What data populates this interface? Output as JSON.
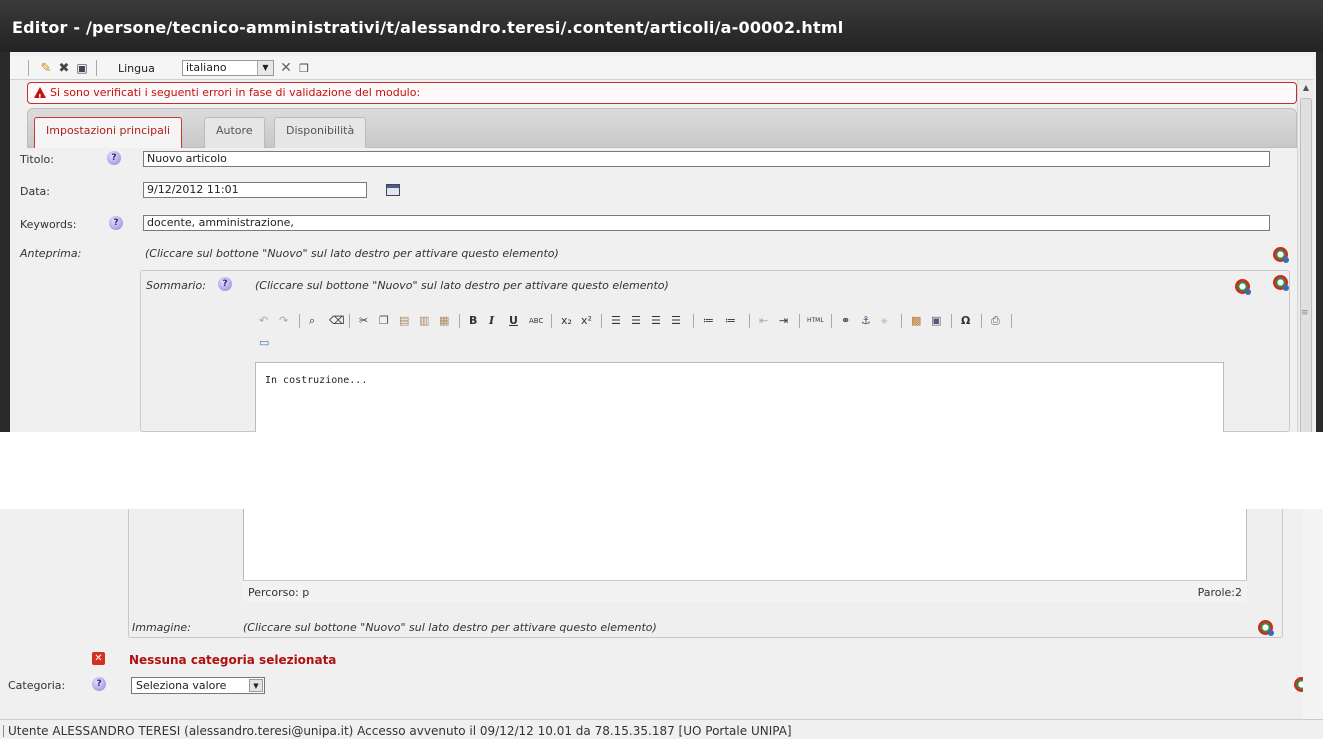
{
  "window": {
    "title": "Editor - /persone/tecnico-amministrativi/t/alessandro.teresi/.content/articoli/a-00002.html"
  },
  "toolbar": {
    "icons": [
      "publish-icon",
      "delete-icon",
      "save-icon"
    ],
    "lingua_label": "Lingua",
    "lingua_value": "italiano",
    "copy_icon": "copy-locale-icon",
    "delete_locale_icon": "delete-locale-icon"
  },
  "error_banner": {
    "text": "Si sono verificati i seguenti errori in fase di validazione del modulo:"
  },
  "tabs": [
    {
      "label": "Impostazioni principali",
      "active": true
    },
    {
      "label": "Autore",
      "active": false
    },
    {
      "label": "Disponibilità",
      "active": false
    }
  ],
  "form": {
    "titolo_label": "Titolo:",
    "titolo_value": "Nuovo articolo",
    "data_label": "Data:",
    "data_value": "9/12/2012 11:01",
    "keywords_label": "Keywords:",
    "keywords_value": "docente, amministrazione,",
    "anteprima_label": "Anteprima:",
    "anteprima_hint": "(Cliccare sul bottone \"Nuovo\" sul lato destro per attivare questo elemento)",
    "sommario_label": "Sommario:",
    "sommario_hint": "(Cliccare sul bottone \"Nuovo\" sul lato destro per attivare questo elemento)",
    "help_symbol": "?"
  },
  "editor": {
    "content": "In costruzione...",
    "path_label": "Percorso: p",
    "word_count_label": "Parole:2",
    "buttons": {
      "bold": "B",
      "italic": "I",
      "underline": "U",
      "strikethrough": "ABC",
      "subscript": "x₂",
      "superscript": "x²",
      "html": "HTML",
      "special_char": "Ω"
    }
  },
  "immagine": {
    "label": "Immagine:",
    "hint": "(Cliccare sul bottone \"Nuovo\" sul lato destro per attivare questo elemento)"
  },
  "categoria": {
    "error": "Nessuna categoria selezionata",
    "label": "Categoria:",
    "select_value": "Seleziona valore"
  },
  "footer": {
    "text": "Utente ALESSANDRO TERESI (alessandro.teresi@unipa.it) Accesso avvenuto il 09/12/12 10.01 da 78.15.35.187 [UO Portale UNIPA]"
  },
  "colors": {
    "titlebar": "#2b2b2b",
    "error": "#c21212",
    "tab_active": "#b4201a"
  }
}
